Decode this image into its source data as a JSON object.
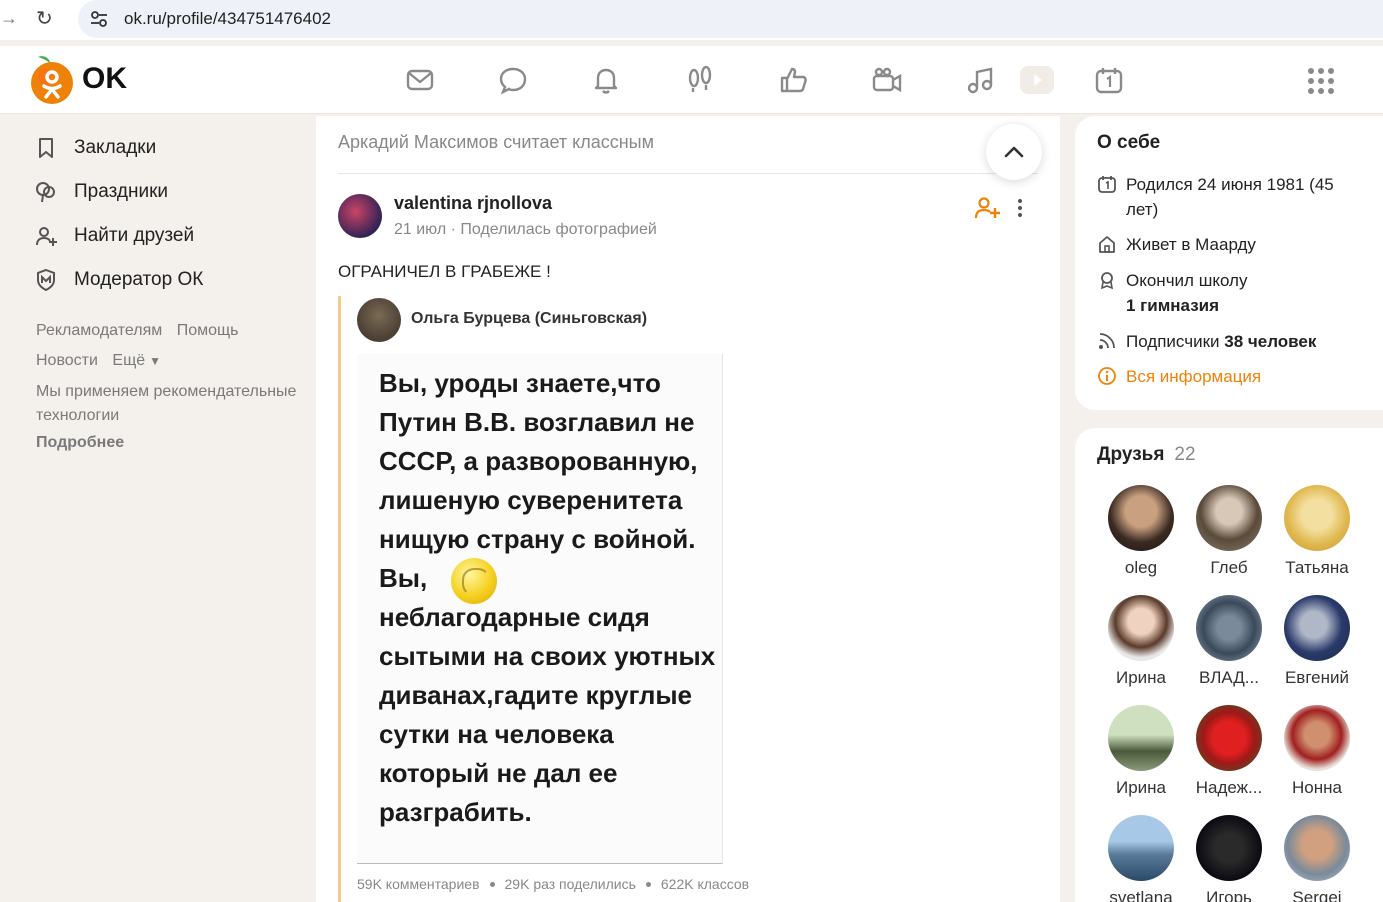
{
  "browser": {
    "url": "ok.ru/profile/434751476402"
  },
  "logo": {
    "text": "OK"
  },
  "nav": {
    "icons": [
      "mail-icon",
      "chat-icon",
      "bell-icon",
      "footprints-icon",
      "like-icon",
      "video-camera-icon",
      "music-icon",
      "play-icon",
      "calendar-icon"
    ]
  },
  "sidebar": {
    "items": [
      {
        "label": "Закладки",
        "icon": "bookmark-icon"
      },
      {
        "label": "Праздники",
        "icon": "balloons-icon"
      },
      {
        "label": "Найти друзей",
        "icon": "add-person-icon"
      },
      {
        "label": "Модератор ОК",
        "icon": "moderator-icon"
      }
    ],
    "links": {
      "advertisers": "Рекламодателям",
      "help": "Помощь",
      "news": "Новости",
      "more": "Ещё"
    },
    "note": "Мы применяем рекомендательные технологии",
    "details": "Подробнее"
  },
  "feed": {
    "header": "Аркадий Максимов считает классным",
    "post": {
      "author": "valentina rjnollova",
      "date": "21 июл",
      "action": "Поделилась фотографией",
      "text": "ОГРАНИЧЕЛ В ГРАБЕЖЕ !",
      "repost_author": "Ольга Бурцева (Синьговская)",
      "photo_text_1": "Вы, уроды знаете,что Путин В.В. возглавил не СССР, а разворованную, лишеную суверенитета нищую страну с войной. Вы,",
      "photo_text_2": "неблагодарные сидя сытыми на своих уютных диванах,гадите круглые сутки на человека который не дал ее разграбить.",
      "stats": {
        "comments": "59K комментариев",
        "shares": "29K раз поделились",
        "likes": "622K классов"
      }
    }
  },
  "about": {
    "title": "О себе",
    "born": "Родился 24 июня 1981 (45 лет)",
    "lives": "Живет в Маарду",
    "school_label": "Окончил школу",
    "school": "1 гимназия",
    "subs_label": "Подписчики",
    "subs": "38 человек",
    "all_info": "Вся информация",
    "accent_color": "#ee8208"
  },
  "friends": {
    "title": "Друзья",
    "count": "22",
    "list": [
      {
        "name": "oleg"
      },
      {
        "name": "Глеб"
      },
      {
        "name": "Татьяна"
      },
      {
        "name": "Ирина"
      },
      {
        "name": "ВЛАД..."
      },
      {
        "name": "Евгений"
      },
      {
        "name": "Ирина"
      },
      {
        "name": "Надеж..."
      },
      {
        "name": "Нонна"
      },
      {
        "name": "svetlana"
      },
      {
        "name": "Игорь"
      },
      {
        "name": "Sergei"
      }
    ]
  }
}
